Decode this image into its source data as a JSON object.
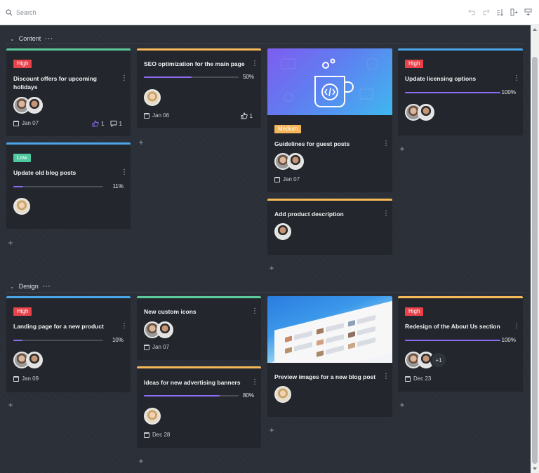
{
  "toolbar": {
    "search_placeholder": "Search",
    "icons": [
      "undo-icon",
      "redo-icon",
      "sort-icon",
      "add-column-icon",
      "add-row-icon"
    ]
  },
  "colors": {
    "high": "#e8424a",
    "medium": "#f5b55a",
    "low": "#4fc9a0",
    "green_line": "#5cc99a",
    "orange_line": "#f5b95a",
    "blue_line": "#4aa6e8",
    "progress_fill": "#8b6cf2"
  },
  "sections": {
    "content": {
      "label": "Content"
    },
    "design": {
      "label": "Design"
    }
  },
  "cards": {
    "c1": {
      "badge": "High",
      "title": "Discount offers for upcoming holidays",
      "date": "Jan 07",
      "likes": "1",
      "comments": "1"
    },
    "c2": {
      "title": "SEO optimization for the main page",
      "progress": 50,
      "pct": "50%",
      "date": "Jan 06",
      "likes": "1"
    },
    "c3": {
      "badge": "Medium",
      "title": "Guidelines for guest posts",
      "date": "Jan 07"
    },
    "c4": {
      "badge": "High",
      "title": "Update licensing options",
      "progress": 100,
      "pct": "100%"
    },
    "c5": {
      "badge": "Low",
      "title": "Update old blog posts",
      "progress": 11,
      "pct": "11%"
    },
    "c6": {
      "title": "Add product description"
    },
    "d1": {
      "badge": "High",
      "title": "Landing page for a new product",
      "progress": 10,
      "pct": "10%",
      "date": "Jan 09"
    },
    "d2": {
      "title": "New custom icons",
      "date": "Jan 07"
    },
    "d3": {
      "title": "Ideas for new advertising banners",
      "progress": 80,
      "pct": "80%",
      "date": "Dec 28"
    },
    "d4": {
      "title": "Preview images for a new blog post"
    },
    "d5": {
      "badge": "High",
      "title": "Redesign of the About Us section",
      "progress": 100,
      "pct": "100%",
      "extra_members": "+1",
      "date": "Dec 23"
    }
  }
}
